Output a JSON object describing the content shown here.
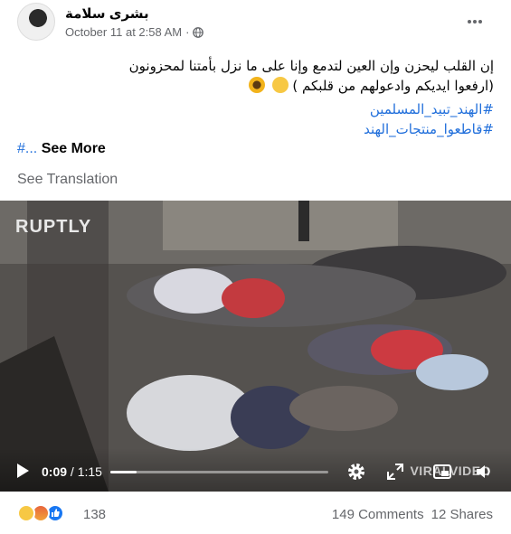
{
  "post": {
    "author": "بشرى سلامة",
    "timestamp": "October 11 at 2:58 AM",
    "separator": "·",
    "privacy_icon": "globe-icon",
    "text_line1": "إن القلب ليحزن وإن العين لتدمع وإنا على ما نزل بأمتنا لمحزونون",
    "text_line2": "(ارفعوا ايديكم وادعولهم من قلبكم )",
    "hashtags": [
      "#الهند_تبيد_المسلمين",
      "#قاطعوا_منتجات_الهند"
    ],
    "see_more_hash": "#...",
    "see_more_label": "See More",
    "see_translation": "See Translation"
  },
  "video": {
    "overlay_logo": "RUPTLY",
    "current_time": "0:09",
    "time_separator": "/",
    "duration": "1:15",
    "progress_fraction": 0.12,
    "watermark": "VIRALVIDEO"
  },
  "footer": {
    "reaction_icons": [
      "sad-reaction",
      "angry-reaction",
      "like-reaction"
    ],
    "reaction_count": "138",
    "comments": "149 Comments",
    "shares": "12 Shares"
  },
  "colors": {
    "link": "#216fdb",
    "secondary_text": "#65676b",
    "like_blue": "#1877f2"
  }
}
